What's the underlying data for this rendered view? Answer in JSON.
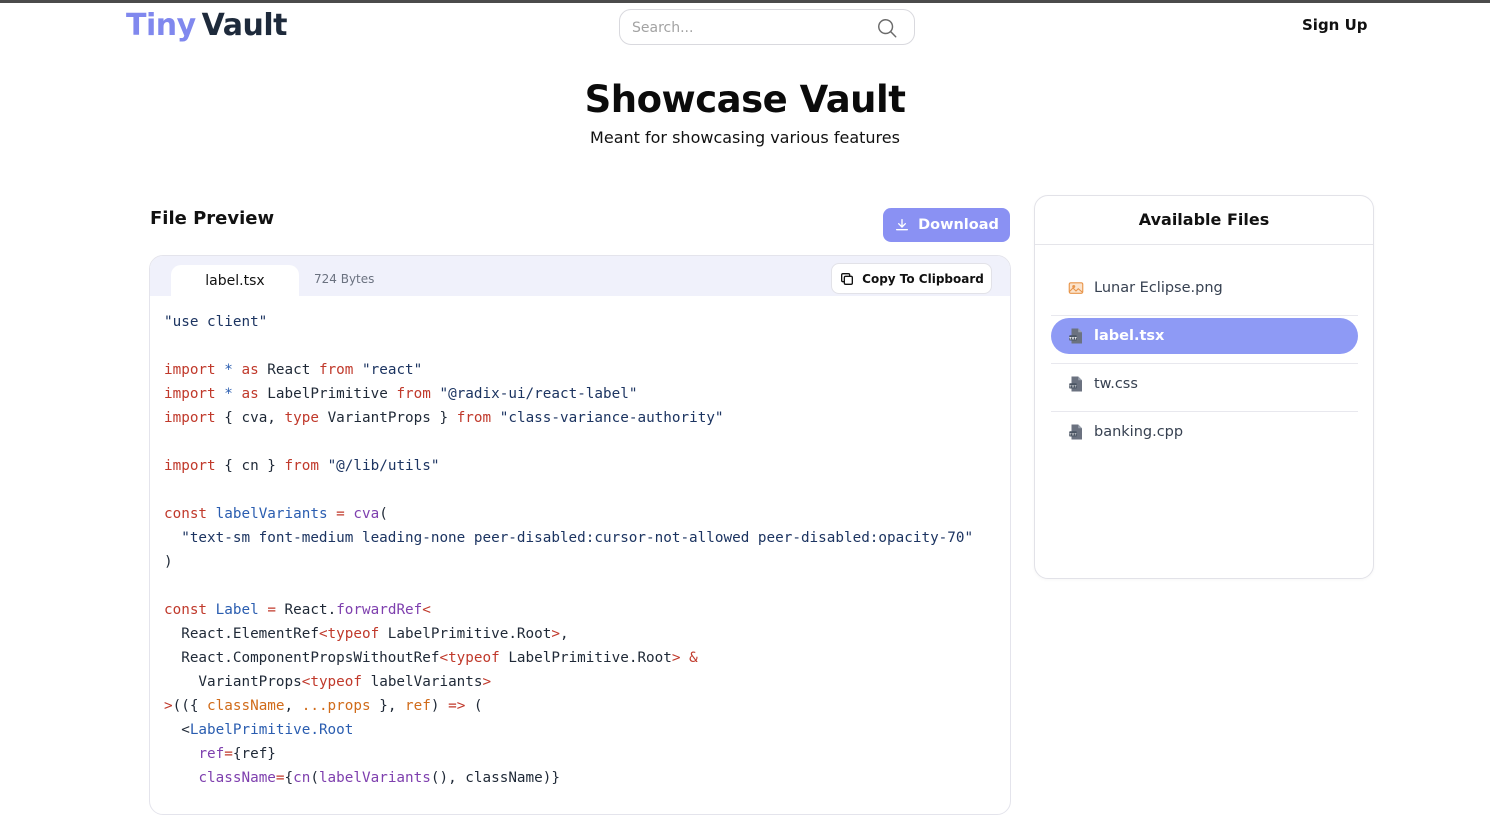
{
  "header": {
    "logo_tiny": "Tiny",
    "logo_vault": "Vault",
    "search_placeholder": "Search...",
    "signup": "Sign Up"
  },
  "hero": {
    "title": "Showcase Vault",
    "subtitle": "Meant for showcasing various features"
  },
  "preview": {
    "title": "File Preview",
    "download_label": "Download",
    "tab_name": "label.tsx",
    "file_size": "724 Bytes",
    "copy_label": "Copy To Clipboard",
    "code_lines": [
      [
        {
          "t": "\"use client\"",
          "c": "str"
        }
      ],
      [],
      [
        {
          "t": "import",
          "c": "red"
        },
        {
          "t": " ",
          "c": "plain"
        },
        {
          "t": "*",
          "c": "blue"
        },
        {
          "t": " ",
          "c": "plain"
        },
        {
          "t": "as",
          "c": "red"
        },
        {
          "t": " React ",
          "c": "plain"
        },
        {
          "t": "from",
          "c": "red"
        },
        {
          "t": " ",
          "c": "plain"
        },
        {
          "t": "\"react\"",
          "c": "str"
        }
      ],
      [
        {
          "t": "import",
          "c": "red"
        },
        {
          "t": " ",
          "c": "plain"
        },
        {
          "t": "*",
          "c": "blue"
        },
        {
          "t": " ",
          "c": "plain"
        },
        {
          "t": "as",
          "c": "red"
        },
        {
          "t": " LabelPrimitive ",
          "c": "plain"
        },
        {
          "t": "from",
          "c": "red"
        },
        {
          "t": " ",
          "c": "plain"
        },
        {
          "t": "\"@radix-ui/react-label\"",
          "c": "str"
        }
      ],
      [
        {
          "t": "import",
          "c": "red"
        },
        {
          "t": " { cva, ",
          "c": "plain"
        },
        {
          "t": "type",
          "c": "red"
        },
        {
          "t": " VariantProps } ",
          "c": "plain"
        },
        {
          "t": "from",
          "c": "red"
        },
        {
          "t": " ",
          "c": "plain"
        },
        {
          "t": "\"class-variance-authority\"",
          "c": "str"
        }
      ],
      [],
      [
        {
          "t": "import",
          "c": "red"
        },
        {
          "t": " { cn } ",
          "c": "plain"
        },
        {
          "t": "from",
          "c": "red"
        },
        {
          "t": " ",
          "c": "plain"
        },
        {
          "t": "\"@/lib/utils\"",
          "c": "str"
        }
      ],
      [],
      [
        {
          "t": "const",
          "c": "red"
        },
        {
          "t": " ",
          "c": "plain"
        },
        {
          "t": "labelVariants",
          "c": "blue"
        },
        {
          "t": " ",
          "c": "plain"
        },
        {
          "t": "=",
          "c": "red"
        },
        {
          "t": " ",
          "c": "plain"
        },
        {
          "t": "cva",
          "c": "purple"
        },
        {
          "t": "(",
          "c": "plain"
        }
      ],
      [
        {
          "t": "  \"text-sm font-medium leading-none peer-disabled:cursor-not-allowed peer-disabled:opacity-70\"",
          "c": "str"
        }
      ],
      [
        {
          "t": ")",
          "c": "plain"
        }
      ],
      [],
      [
        {
          "t": "const",
          "c": "red"
        },
        {
          "t": " ",
          "c": "plain"
        },
        {
          "t": "Label",
          "c": "blue"
        },
        {
          "t": " ",
          "c": "plain"
        },
        {
          "t": "=",
          "c": "red"
        },
        {
          "t": " React.",
          "c": "plain"
        },
        {
          "t": "forwardRef",
          "c": "purple"
        },
        {
          "t": "<",
          "c": "red"
        }
      ],
      [
        {
          "t": "  React.ElementRef",
          "c": "plain"
        },
        {
          "t": "<",
          "c": "red"
        },
        {
          "t": "typeof",
          "c": "red"
        },
        {
          "t": " LabelPrimitive.Root",
          "c": "plain"
        },
        {
          "t": ">",
          "c": "red"
        },
        {
          "t": ",",
          "c": "plain"
        }
      ],
      [
        {
          "t": "  React.ComponentPropsWithoutRef",
          "c": "plain"
        },
        {
          "t": "<",
          "c": "red"
        },
        {
          "t": "typeof",
          "c": "red"
        },
        {
          "t": " LabelPrimitive.Root",
          "c": "plain"
        },
        {
          "t": ">",
          "c": "red"
        },
        {
          "t": " ",
          "c": "plain"
        },
        {
          "t": "&",
          "c": "red"
        }
      ],
      [
        {
          "t": "    VariantProps",
          "c": "plain"
        },
        {
          "t": "<",
          "c": "red"
        },
        {
          "t": "typeof",
          "c": "red"
        },
        {
          "t": " labelVariants",
          "c": "plain"
        },
        {
          "t": ">",
          "c": "red"
        }
      ],
      [
        {
          "t": ">",
          "c": "red"
        },
        {
          "t": "(({ ",
          "c": "plain"
        },
        {
          "t": "className",
          "c": "orange"
        },
        {
          "t": ", ",
          "c": "plain"
        },
        {
          "t": "...props",
          "c": "orange"
        },
        {
          "t": " }, ",
          "c": "plain"
        },
        {
          "t": "ref",
          "c": "orange"
        },
        {
          "t": ") ",
          "c": "plain"
        },
        {
          "t": "=>",
          "c": "red"
        },
        {
          "t": " (",
          "c": "plain"
        }
      ],
      [
        {
          "t": "  <",
          "c": "plain"
        },
        {
          "t": "LabelPrimitive.Root",
          "c": "blue"
        }
      ],
      [
        {
          "t": "    ",
          "c": "plain"
        },
        {
          "t": "ref",
          "c": "purple"
        },
        {
          "t": "=",
          "c": "red"
        },
        {
          "t": "{ref}",
          "c": "plain"
        }
      ],
      [
        {
          "t": "    ",
          "c": "plain"
        },
        {
          "t": "className",
          "c": "purple"
        },
        {
          "t": "=",
          "c": "red"
        },
        {
          "t": "{",
          "c": "plain"
        },
        {
          "t": "cn",
          "c": "purple"
        },
        {
          "t": "(",
          "c": "plain"
        },
        {
          "t": "labelVariants",
          "c": "purple"
        },
        {
          "t": "(), className)}",
          "c": "plain"
        }
      ]
    ]
  },
  "files": {
    "title": "Available Files",
    "items": [
      {
        "name": "Lunar Eclipse.png",
        "icon": "image-icon",
        "selected": false
      },
      {
        "name": "label.tsx",
        "icon": "text-file-icon",
        "selected": true
      },
      {
        "name": "tw.css",
        "icon": "text-file-icon",
        "selected": false
      },
      {
        "name": "banking.cpp",
        "icon": "text-file-icon",
        "selected": false
      }
    ]
  },
  "colors": {
    "accent": "#8a91f3",
    "selected_item": "#8e9af5",
    "logo_tiny": "#8088ee",
    "logo_vault": "#1e2a3b"
  }
}
